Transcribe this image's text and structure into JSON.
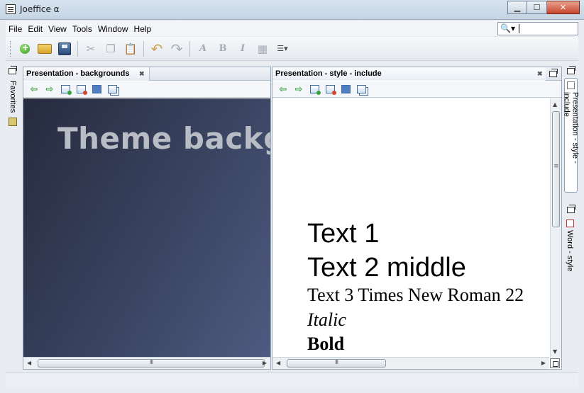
{
  "window": {
    "title": "Joeffice α",
    "minimize_label": "▁",
    "maximize_label": "☐",
    "close_label": "✕"
  },
  "menu": {
    "items": [
      "File",
      "Edit",
      "View",
      "Tools",
      "Window",
      "Help"
    ]
  },
  "search": {
    "value": "",
    "icon_glyph": "🔍▾"
  },
  "toolbar": {
    "undo_glyph": "↶",
    "redo_glyph": "↷",
    "cut_glyph": "✂",
    "copy_glyph": "❐",
    "paste_glyph": "📋",
    "font_glyph": "A",
    "bold_glyph": "B",
    "italic_glyph": "I",
    "table_glyph": "▦",
    "align_glyph": "☰▾"
  },
  "left_strip": {
    "favorites_label": "Favorites"
  },
  "right_strip": {
    "tab1_label": "Presentation - style - include",
    "tab2_label": "Word - style"
  },
  "panels": {
    "left": {
      "tab_label": "Presentation - backgrounds",
      "slide_title": "Theme backg"
    },
    "right": {
      "tab_label": "Presentation - style - include",
      "lines": [
        "Text 1",
        "Text 2 middle",
        "Text 3 Times New Roman 22",
        "Italic",
        "Bold"
      ]
    },
    "close_glyph": "✖",
    "back_glyph": "⇦",
    "forward_glyph": "⇨"
  },
  "colors": {
    "accent": "#3f6ea5",
    "slide_dark": "#3a4461"
  }
}
